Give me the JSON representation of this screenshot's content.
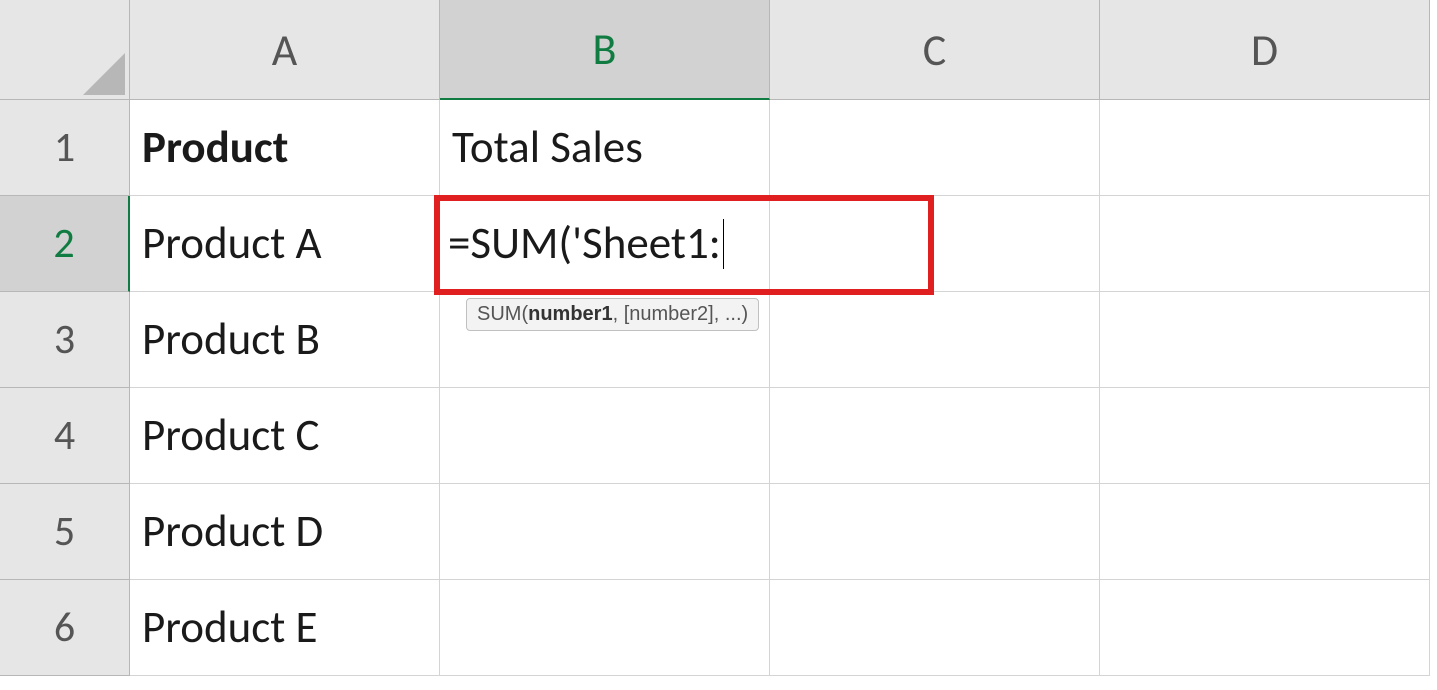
{
  "columns": [
    "A",
    "B",
    "C",
    "D"
  ],
  "rows": [
    "1",
    "2",
    "3",
    "4",
    "5",
    "6"
  ],
  "activeColumn": "B",
  "activeRow": "2",
  "cells": {
    "A1": {
      "value": "Product",
      "bold": true
    },
    "B1": {
      "value": "Total Sales",
      "bold": false
    },
    "A2": {
      "value": "Product A",
      "bold": false
    },
    "B2": {
      "value": "=SUM('Sheet1:",
      "bold": false,
      "editing": true
    },
    "A3": {
      "value": "Product B",
      "bold": false
    },
    "A4": {
      "value": "Product C",
      "bold": false
    },
    "A5": {
      "value": "Product D",
      "bold": false
    },
    "A6": {
      "value": "Product E",
      "bold": false
    }
  },
  "tooltip": {
    "prefix": "SUM(",
    "boldPart": "number1",
    "suffix": ", [number2], ...)"
  },
  "highlightCell": "B2"
}
